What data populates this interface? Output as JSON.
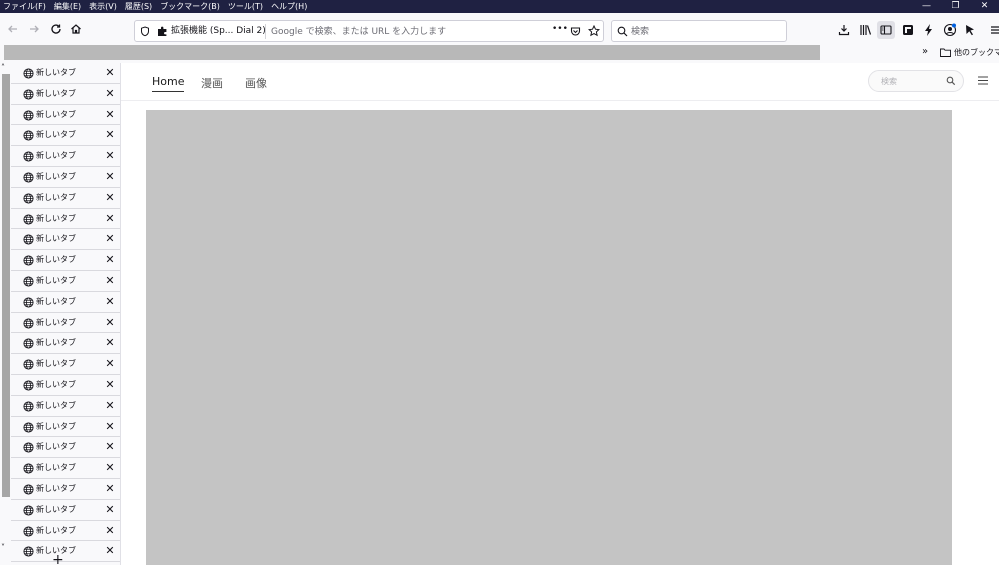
{
  "menubar": {
    "items": [
      "ファイル(F)",
      "編集(E)",
      "表示(V)",
      "履歴(S)",
      "ブックマーク(B)",
      "ツール(T)",
      "ヘルプ(H)"
    ],
    "controls": [
      "—",
      "❐",
      "✕"
    ]
  },
  "urlbar": {
    "extension_label": "拡張機能 (Sp... Dial 2)",
    "placeholder": "Google で検索、または URL を入力します",
    "more": "•••"
  },
  "searchbar": {
    "placeholder": "検索"
  },
  "bookmarks": {
    "more": "»",
    "other_label": "他のブックマーク"
  },
  "sidebar": {
    "tabs": [
      "新しいタブ",
      "新しいタブ",
      "新しいタブ",
      "新しいタブ",
      "新しいタブ",
      "新しいタブ",
      "新しいタブ",
      "新しいタブ",
      "新しいタブ",
      "新しいタブ",
      "新しいタブ",
      "新しいタブ",
      "新しいタブ",
      "新しいタブ",
      "新しいタブ",
      "新しいタブ",
      "新しいタブ",
      "新しいタブ",
      "新しいタブ",
      "新しいタブ",
      "新しいタブ",
      "新しいタブ",
      "新しいタブ",
      "新しいタブ"
    ],
    "close_glyph": "✕",
    "new_tab_glyph": "+",
    "scroll_up": "˄",
    "scroll_down": "˅"
  },
  "content": {
    "tabs": [
      "Home",
      "漫画",
      "画像"
    ],
    "active_tab": "Home",
    "search_placeholder": "検索"
  },
  "colors": {
    "menubar_bg": "#1f2142",
    "gray_area": "#c4c4c4",
    "accent": "#0060df"
  }
}
